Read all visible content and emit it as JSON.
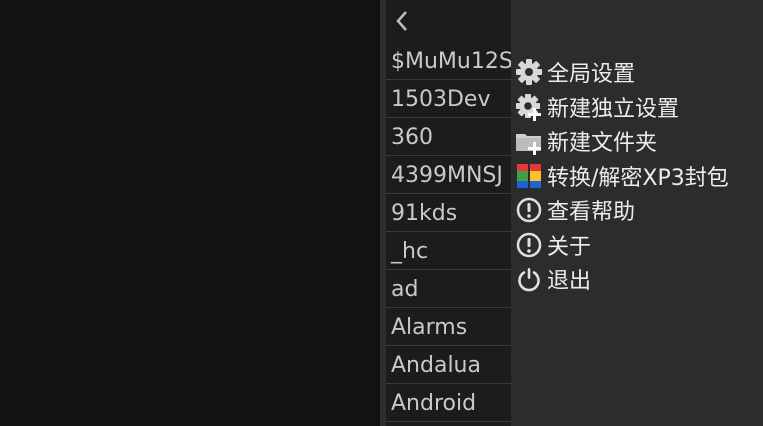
{
  "files": [
    "$MuMu12S",
    "1503Dev",
    "360",
    "4399MNSJ",
    "91kds",
    "_hc",
    "ad",
    "Alarms",
    "Andalua",
    "Android"
  ],
  "menu": {
    "items": [
      {
        "label": "全局设置",
        "icon": "gear-icon"
      },
      {
        "label": "新建独立设置",
        "icon": "gear-plus-icon"
      },
      {
        "label": "新建文件夹",
        "icon": "folder-plus-icon"
      },
      {
        "label": "转换/解密XP3封包",
        "icon": "colored-blocks-icon"
      },
      {
        "label": "查看帮助",
        "icon": "exclamation-circle-icon"
      },
      {
        "label": "关于",
        "icon": "exclamation-circle-icon"
      },
      {
        "label": "退出",
        "icon": "power-icon"
      }
    ]
  },
  "colors": {
    "background": "#121212",
    "file_panel": "#1c1c1c",
    "menu_panel": "#2c2c2c",
    "text": "#ececec"
  }
}
